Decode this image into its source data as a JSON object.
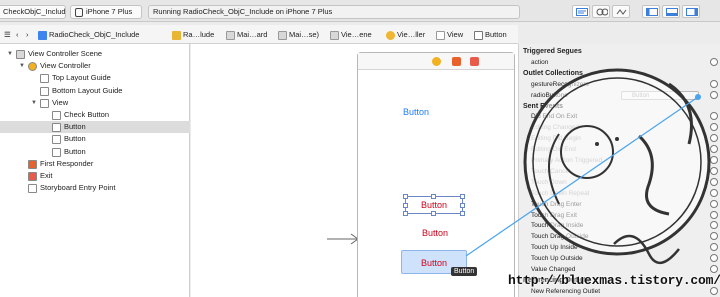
{
  "toolbar": {
    "scheme": "RadioCheck_ObjC_Include",
    "scheme_visible": "CheckObjC_Include",
    "destination": "iPhone 7 Plus",
    "status": "Running RadioCheck_ObjC_Include on iPhone 7 Plus"
  },
  "jumpbar": {
    "items": [
      {
        "label": "RadioCheck_ObjC_Include",
        "color": "#3d84ef"
      },
      {
        "label": "Ra…lude",
        "color": "#e8b634"
      },
      {
        "label": "Mai…ard",
        "color": "#d8d8d8"
      },
      {
        "label": "Mai…se)",
        "color": "#d8d8d8"
      },
      {
        "label": "Vie…ene",
        "color": "#f0b531"
      },
      {
        "label": "Vie…ller",
        "color": "#f0b531"
      },
      {
        "label": "View",
        "color": "#cccccc"
      },
      {
        "label": "Button",
        "color": "#5a9ae8"
      }
    ]
  },
  "outline": {
    "rows": [
      {
        "label": "View Controller Scene",
        "indent": 0,
        "icon": "scene-icon",
        "disclosure": "▼",
        "selected": false
      },
      {
        "label": "View Controller",
        "indent": 1,
        "icon": "view-controller-icon",
        "disclosure": "▼",
        "selected": false
      },
      {
        "label": "Top Layout Guide",
        "indent": 2,
        "icon": "layout-guide-icon",
        "disclosure": "",
        "selected": false
      },
      {
        "label": "Bottom Layout Guide",
        "indent": 2,
        "icon": "layout-guide-icon",
        "disclosure": "",
        "selected": false
      },
      {
        "label": "View",
        "indent": 2,
        "icon": "view-icon",
        "disclosure": "▼",
        "selected": false
      },
      {
        "label": "Check Button",
        "indent": 3,
        "icon": "button-icon",
        "disclosure": "",
        "selected": false
      },
      {
        "label": "Button",
        "indent": 3,
        "icon": "button-icon",
        "disclosure": "",
        "selected": true
      },
      {
        "label": "Button",
        "indent": 3,
        "icon": "button-icon",
        "disclosure": "",
        "selected": false
      },
      {
        "label": "Button",
        "indent": 3,
        "icon": "button-icon",
        "disclosure": "",
        "selected": false
      },
      {
        "label": "First Responder",
        "indent": 1,
        "icon": "first-responder-icon",
        "disclosure": "",
        "selected": false
      },
      {
        "label": "Exit",
        "indent": 1,
        "icon": "exit-icon",
        "disclosure": "",
        "selected": false
      },
      {
        "label": "Storyboard Entry Point",
        "indent": 1,
        "icon": "entry-point-icon",
        "disclosure": "",
        "selected": false
      }
    ]
  },
  "canvas": {
    "buttons": [
      {
        "label": "Button",
        "color": "#1c7cf2",
        "name": "canvas-button-top"
      },
      {
        "label": "Button",
        "color": "#d0021b",
        "name": "canvas-button-selected"
      },
      {
        "label": "Button",
        "color": "#d0021b",
        "name": "canvas-button-red"
      },
      {
        "label": "Button",
        "color": "#d0021b",
        "name": "canvas-button-highlighted"
      }
    ],
    "tooltip": "Button"
  },
  "inspector": {
    "rows": [
      {
        "text": "Triggered Segues",
        "kind": "hdr"
      },
      {
        "text": "action",
        "kind": "item",
        "circle": true
      },
      {
        "text": "Outlet Collections",
        "kind": "hdr"
      },
      {
        "text": "gestureRecognizers",
        "kind": "item",
        "circle": true
      },
      {
        "text": "radioButtons",
        "kind": "item",
        "circle": true,
        "target": "Button"
      },
      {
        "text": "Sent Events",
        "kind": "hdr"
      },
      {
        "text": "Did End On Exit",
        "kind": "item",
        "circle": true
      },
      {
        "text": "Editing Changed",
        "kind": "dim",
        "circle": true
      },
      {
        "text": "Editing Did Begin",
        "kind": "dim",
        "circle": true
      },
      {
        "text": "Editing Did End",
        "kind": "dim",
        "circle": true
      },
      {
        "text": "Primary Action Triggered",
        "kind": "dim",
        "circle": true
      },
      {
        "text": "Touch Cancel",
        "kind": "dim",
        "circle": true
      },
      {
        "text": "Touch Down",
        "kind": "dim",
        "circle": true
      },
      {
        "text": "Touch Down Repeat",
        "kind": "dim",
        "circle": true
      },
      {
        "text": "Touch Drag Enter",
        "kind": "item",
        "circle": true
      },
      {
        "text": "Touch Drag Exit",
        "kind": "item",
        "circle": true
      },
      {
        "text": "Touch Drag Inside",
        "kind": "item",
        "circle": true
      },
      {
        "text": "Touch Drag Outside",
        "kind": "item",
        "circle": true
      },
      {
        "text": "Touch Up Inside",
        "kind": "item",
        "circle": true
      },
      {
        "text": "Touch Up Outside",
        "kind": "item",
        "circle": true
      },
      {
        "text": "Value Changed",
        "kind": "item",
        "circle": true
      },
      {
        "text": "Referencing Outlets",
        "kind": "hdr"
      },
      {
        "text": "New Referencing Outlet",
        "kind": "item",
        "circle": true
      }
    ]
  },
  "watermark": "http://bluexmas.tistory.com/"
}
